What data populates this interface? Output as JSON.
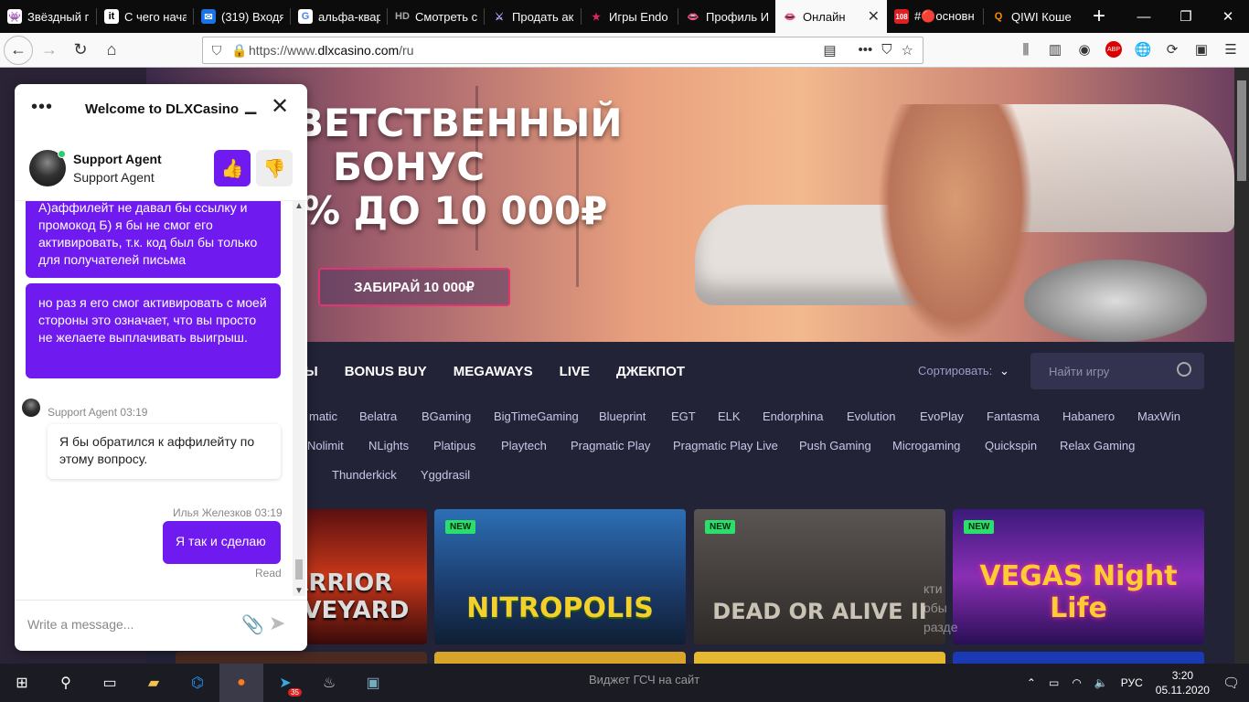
{
  "browser": {
    "tabs": [
      {
        "title": "Звёздный г",
        "favicon": "boostr-icon"
      },
      {
        "title": "С чего нача",
        "favicon": "it-icon"
      },
      {
        "title": "(319) Входя",
        "favicon": "mail-icon"
      },
      {
        "title": "альфа-квар",
        "favicon": "google-icon"
      },
      {
        "title": "Смотреть с",
        "favicon": "hd-icon"
      },
      {
        "title": "Продать ак",
        "favicon": "knife-icon"
      },
      {
        "title": "Игры Endo",
        "favicon": "star-icon"
      },
      {
        "title": "Профиль И",
        "favicon": "lips-icon"
      },
      {
        "title": "Онлайн",
        "favicon": "lips-icon",
        "active": true
      },
      {
        "title": "#🔴основн",
        "favicon": "badge-icon",
        "badge": "108"
      },
      {
        "title": "QIWI Коше",
        "favicon": "qiwi-icon"
      }
    ],
    "new_tab": "+",
    "url_prefix": "https://www.",
    "url_domain": "dlxcasino.com",
    "url_suffix": "/ru",
    "ext_badge": "ABP"
  },
  "hero": {
    "line1": "ВЕТСТВЕННЫЙ",
    "line2": "БОНУС",
    "line3": "% ДО 10 000₽",
    "button": "ЗАБИРАЙ 10 000₽"
  },
  "menu": {
    "items": [
      "Ы",
      "BONUS BUY",
      "MEGAWAYS",
      "LIVE",
      "ДЖЕКПОТ"
    ],
    "sort_label": "Сортировать:",
    "search_placeholder": "Найти игру"
  },
  "providers": {
    "row1": [
      "matic",
      "Belatra",
      "BGaming",
      "BigTimeGaming",
      "Blueprint",
      "EGT",
      "ELK",
      "Endorphina",
      "Evolution",
      "EvoPlay",
      "Fantasma",
      "Habanero",
      "MaxWin"
    ],
    "row2": [
      "Nolimit",
      "NLights",
      "Platipus",
      "Playtech",
      "Pragmatic Play",
      "Pragmatic Play Live",
      "Push Gaming",
      "Microgaming",
      "Quickspin",
      "Relax Gaming"
    ],
    "row3": [
      "Thunderkick",
      "Yggdrasil"
    ]
  },
  "games": [
    {
      "title": "WARRIOR GRAVEYARD",
      "new": ""
    },
    {
      "title": "NITROPOLIS",
      "new": "NEW"
    },
    {
      "title": "DEAD OR ALIVE II",
      "new": "NEW"
    },
    {
      "title": "VEGAS Night Life",
      "new": "NEW"
    }
  ],
  "overlay": {
    "line1": "кти",
    "line2": "обы",
    "line3": "разде"
  },
  "chat": {
    "title": "Welcome to DLXCasino",
    "agent_name": "Support Agent",
    "agent_role": "Support Agent",
    "messages": [
      {
        "from": "user",
        "text": "А)аффилейт не давал бы ссылку и промокод Б) я бы не смог его активировать, т.к. код был бы только для получателей письма"
      },
      {
        "from": "user",
        "text": "но раз я его смог активировать с моей стороны это означает, что вы просто не желаете выплачивать выигрыш."
      },
      {
        "from": "agent",
        "meta": "Support Agent 03:19",
        "text": "Я бы обратился к аффилейту по этому вопросу."
      },
      {
        "from": "user",
        "meta": "Илья Железков 03:19",
        "text": "Я так и сделаю",
        "status": "Read"
      }
    ],
    "composer_placeholder": "Write a message..."
  },
  "taskbar": {
    "center_text": "Виджет ГСЧ на сайт",
    "telegram_badge": "35",
    "lang": "РУС",
    "time": "3:20",
    "date": "05.11.2020"
  }
}
